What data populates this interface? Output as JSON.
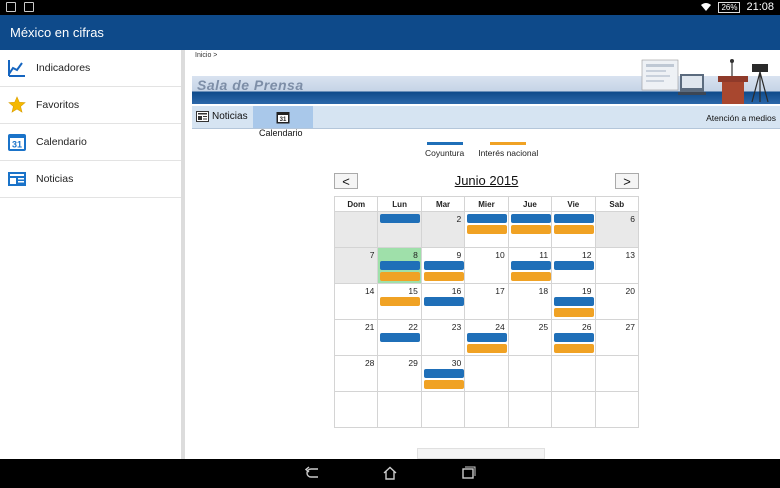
{
  "status_bar": {
    "battery": "26%",
    "time": "21:08"
  },
  "app": {
    "title": "México en cifras"
  },
  "sidebar": {
    "items": [
      {
        "label": "Indicadores",
        "icon": "chart-icon"
      },
      {
        "label": "Favoritos",
        "icon": "star-icon"
      },
      {
        "label": "Calendario",
        "icon": "calendar-icon",
        "icon_text": "31"
      },
      {
        "label": "Noticias",
        "icon": "newspaper-icon"
      }
    ]
  },
  "breadcrumb": "Inicio >",
  "banner": {
    "title": "Sala de Prensa"
  },
  "tabs": {
    "noticias": "Noticias",
    "calendario": "Calendario",
    "calendario_icon_text": "31",
    "atencion": "Atención a medios"
  },
  "legend": [
    {
      "label": "Coyuntura",
      "color": "#1f6fb8"
    },
    {
      "label": "Interés nacional",
      "color": "#f0a224"
    }
  ],
  "calendar": {
    "month": "Junio 2015",
    "prev": "<",
    "next": ">",
    "weekdays": [
      "Dom",
      "Lun",
      "Mar",
      "Mier",
      "Jue",
      "Vie",
      "Sab"
    ],
    "weeks": [
      [
        {
          "d": "",
          "gray": true,
          "ev": []
        },
        {
          "d": "",
          "gray": true,
          "ev": [
            "blue"
          ]
        },
        {
          "d": "2",
          "gray": true,
          "ev": []
        },
        {
          "d": "",
          "ev": [
            "blue",
            "orange"
          ]
        },
        {
          "d": "",
          "ev": [
            "blue",
            "orange"
          ]
        },
        {
          "d": "",
          "ev": [
            "blue",
            "orange"
          ]
        },
        {
          "d": "6",
          "gray": true,
          "ev": []
        }
      ],
      [
        {
          "d": "7",
          "gray": true,
          "ev": []
        },
        {
          "d": "8",
          "today": true,
          "ev": [
            "blue",
            "orange"
          ]
        },
        {
          "d": "9",
          "ev": [
            "blue",
            "orange"
          ]
        },
        {
          "d": "10",
          "ev": []
        },
        {
          "d": "11",
          "ev": [
            "blue",
            "orange"
          ]
        },
        {
          "d": "12",
          "ev": [
            "blue"
          ]
        },
        {
          "d": "13",
          "ev": []
        }
      ],
      [
        {
          "d": "14",
          "ev": []
        },
        {
          "d": "15",
          "ev": [
            "orange"
          ]
        },
        {
          "d": "16",
          "ev": [
            "blue"
          ]
        },
        {
          "d": "17",
          "ev": []
        },
        {
          "d": "18",
          "ev": []
        },
        {
          "d": "19",
          "ev": [
            "blue",
            "orange"
          ]
        },
        {
          "d": "20",
          "ev": []
        }
      ],
      [
        {
          "d": "21",
          "ev": []
        },
        {
          "d": "22",
          "ev": [
            "blue"
          ]
        },
        {
          "d": "23",
          "ev": []
        },
        {
          "d": "24",
          "ev": [
            "blue",
            "orange"
          ]
        },
        {
          "d": "25",
          "ev": []
        },
        {
          "d": "26",
          "ev": [
            "blue",
            "orange"
          ]
        },
        {
          "d": "27",
          "ev": []
        }
      ],
      [
        {
          "d": "28",
          "ev": []
        },
        {
          "d": "29",
          "ev": []
        },
        {
          "d": "30",
          "ev": [
            "blue",
            "orange"
          ]
        },
        {
          "d": "",
          "ev": []
        },
        {
          "d": "",
          "ev": []
        },
        {
          "d": "",
          "ev": []
        },
        {
          "d": "",
          "ev": []
        }
      ],
      [
        {
          "d": "",
          "ev": []
        },
        {
          "d": "",
          "ev": []
        },
        {
          "d": "",
          "ev": []
        },
        {
          "d": "",
          "ev": []
        },
        {
          "d": "",
          "ev": []
        },
        {
          "d": "",
          "ev": []
        },
        {
          "d": "",
          "ev": []
        }
      ]
    ]
  },
  "colors": {
    "accent": "#0e4a8a",
    "coyuntura": "#1f6fb8",
    "interes": "#f0a224",
    "today": "#9fe0aa"
  }
}
